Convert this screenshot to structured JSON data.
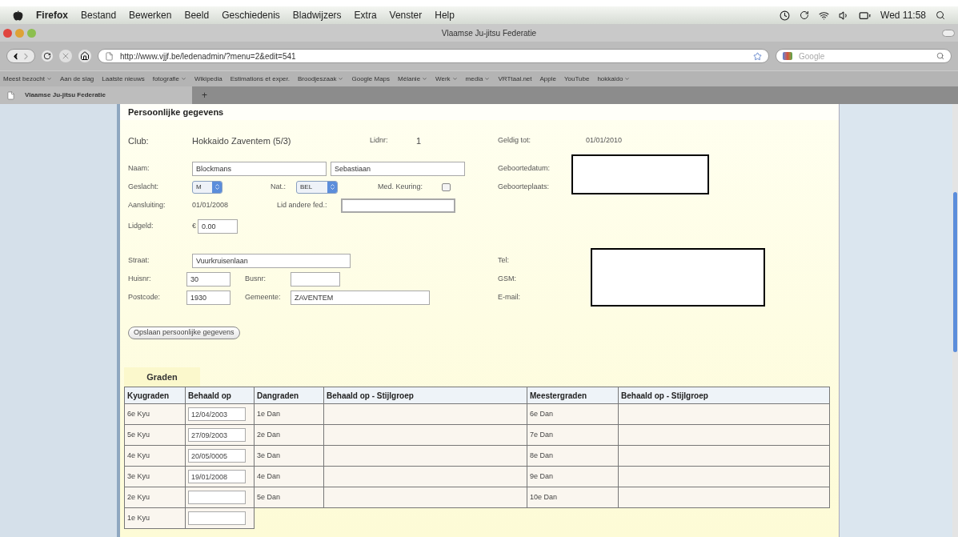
{
  "menubar": {
    "app": "Firefox",
    "items": [
      "Bestand",
      "Bewerken",
      "Beeld",
      "Geschiedenis",
      "Bladwijzers",
      "Extra",
      "Venster",
      "Help"
    ],
    "clock": "Wed 11:58"
  },
  "window": {
    "title": "Vlaamse Ju-jitsu Federatie"
  },
  "toolbar": {
    "url": "http://www.vjjf.be/ledenadmin/?menu=2&edit=541",
    "search_placeholder": "Google"
  },
  "bookmarks": [
    {
      "label": "Meest bezocht",
      "dropdown": true
    },
    {
      "label": "Aan de slag",
      "dropdown": false
    },
    {
      "label": "Laatste nieuws",
      "dropdown": false
    },
    {
      "label": "fotografie",
      "dropdown": true
    },
    {
      "label": "Wikipedia",
      "dropdown": false
    },
    {
      "label": "Estimations et exper.",
      "dropdown": false
    },
    {
      "label": "Broodjeszaak",
      "dropdown": true
    },
    {
      "label": "Google Maps",
      "dropdown": false
    },
    {
      "label": "Mélanie",
      "dropdown": true
    },
    {
      "label": "Werk",
      "dropdown": true
    },
    {
      "label": "media",
      "dropdown": true
    },
    {
      "label": "VRTtaal.net",
      "dropdown": false
    },
    {
      "label": "Apple",
      "dropdown": false
    },
    {
      "label": "YouTube",
      "dropdown": false
    },
    {
      "label": "hokkaido",
      "dropdown": true
    }
  ],
  "tabs": [
    {
      "label": "Vlaamse Ju-jitsu Federatie",
      "selected": true
    }
  ],
  "new_tab": "+",
  "personal": {
    "title": "Persoonlijke gegevens",
    "club_label": "Club:",
    "club": "Hokkaido Zaventem (5/3)",
    "lidnr_label": "Lidnr:",
    "lidnr": "1",
    "geldig_label": "Geldig tot:",
    "geldig": "01/01/2010",
    "naam_label": "Naam:",
    "achternaam": "Blockmans",
    "voornaam": "Sebastiaan",
    "geslacht_label": "Geslacht:",
    "geslacht": "M",
    "nat_label": "Nat.:",
    "nat": "BEL",
    "keuring_label": "Med. Keuring:",
    "keuring_checked": false,
    "aansluiting_label": "Aansluiting:",
    "aansluiting": "01/01/2008",
    "andere_fed_label": "Lid andere fed.:",
    "lidgeld_label": "Lidgeld:",
    "currency": "€",
    "lidgeld": "0.00",
    "geboortedatum_label": "Geboortedatum:",
    "geboorteplaats_label": "Geboorteplaats:",
    "straat_label": "Straat:",
    "straat": "Vuurkruisenlaan",
    "huisnr_label": "Huisnr:",
    "huisnr": "30",
    "busnr_label": "Busnr:",
    "postcode_label": "Postcode:",
    "postcode": "1930",
    "gemeente_label": "Gemeente:",
    "gemeente": "ZAVENTEM",
    "tel_label": "Tel:",
    "gsm_label": "GSM:",
    "email_label": "E-mail:",
    "save_button": "Opslaan persoonlijke gegevens"
  },
  "graden": {
    "title": "Graden",
    "columns": [
      "Kyugraden",
      "Behaald op",
      "Dangraden",
      "Behaald op - Stijlgroep",
      "Meestergraden",
      "Behaald op - Stijlgroep"
    ],
    "rows": [
      {
        "kyu": "6e Kyu",
        "date": "12/04/2003",
        "dan": "1e Dan",
        "meester": "6e Dan"
      },
      {
        "kyu": "5e Kyu",
        "date": "27/09/2003",
        "dan": "2e Dan",
        "meester": "7e Dan"
      },
      {
        "kyu": "4e Kyu",
        "date": "20/05/0005",
        "dan": "3e Dan",
        "meester": "8e Dan"
      },
      {
        "kyu": "3e Kyu",
        "date": "19/01/2008",
        "dan": "4e Dan",
        "meester": "9e Dan"
      },
      {
        "kyu": "2e Kyu",
        "date": "",
        "dan": "5e Dan",
        "meester": "10e Dan"
      },
      {
        "kyu": "1e Kyu",
        "date": ""
      }
    ]
  }
}
